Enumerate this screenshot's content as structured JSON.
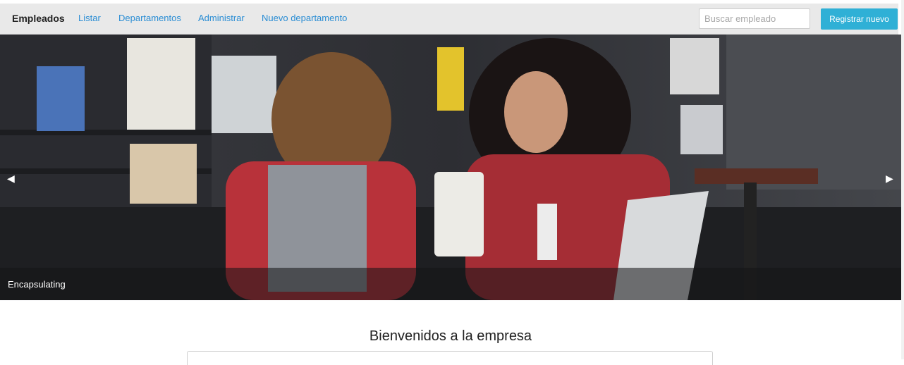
{
  "navbar": {
    "brand": "Empleados",
    "links": [
      "Listar",
      "Departamentos",
      "Administrar",
      "Nuevo departamento"
    ],
    "search": {
      "placeholder": "Buscar empleado",
      "value": ""
    },
    "register_label": "Registrar nuevo"
  },
  "carousel": {
    "caption": "Encapsulating",
    "prev_arrow": "◀",
    "next_arrow": "▶",
    "image": "photo-two-women-talking-in-library"
  },
  "main": {
    "welcome_title": "Bienvenidos a la empresa"
  },
  "colors": {
    "link": "#2a8dd4",
    "button": "#2fb0d6",
    "navbar_bg": "#e9e9e9"
  }
}
